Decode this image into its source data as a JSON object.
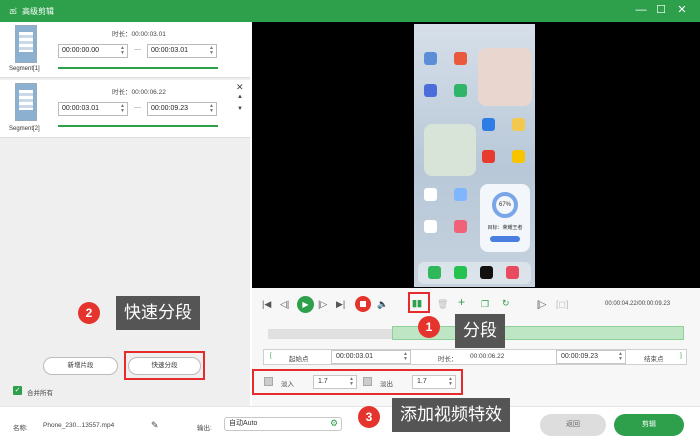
{
  "window": {
    "title": "高级剪辑",
    "min": "—",
    "max": "☐",
    "close": "✕"
  },
  "segments": [
    {
      "label": "Segment[1]",
      "duration": "时长：00:00:03.01",
      "start": "00:00:00.00",
      "end": "00:00:03.01"
    },
    {
      "label": "Segment[2]",
      "duration": "时长：00:00:06.22",
      "start": "00:00:03.01",
      "end": "00:00:09.23"
    }
  ],
  "left_buttons": {
    "new_segment": "新增片段",
    "quick_split": "快速分段",
    "merge_all": "合并所有"
  },
  "callouts": {
    "c1": "分段",
    "c2": "快速分段",
    "c3": "添加视频特效",
    "n1": "1",
    "n2": "2",
    "n3": "3"
  },
  "phone": {
    "app_label": "目标：荣耀王者",
    "progress": "67%"
  },
  "playback": {
    "time": "00:00:04.22/00:00:09.23"
  },
  "trim": {
    "start_label": "起始点",
    "start_value": "00:00:03.01",
    "duration_label": "时长：",
    "duration_value": "00:00:06.22",
    "end_value": "00:00:09.23",
    "end_label": "结束点"
  },
  "fade": {
    "in_label": "淡入",
    "in_value": "1.7",
    "out_label": "淡出",
    "out_value": "1.7"
  },
  "bottom": {
    "name_label": "名称:",
    "name_value": "Phone_230...13557.mp4",
    "output_label": "输出:",
    "output_value": "自动Auto",
    "back_button": "返回",
    "clip_button": "剪辑"
  },
  "colors": {
    "brand": "#2ea04c",
    "callout": "#555555",
    "highlight": "#e52b2b"
  }
}
